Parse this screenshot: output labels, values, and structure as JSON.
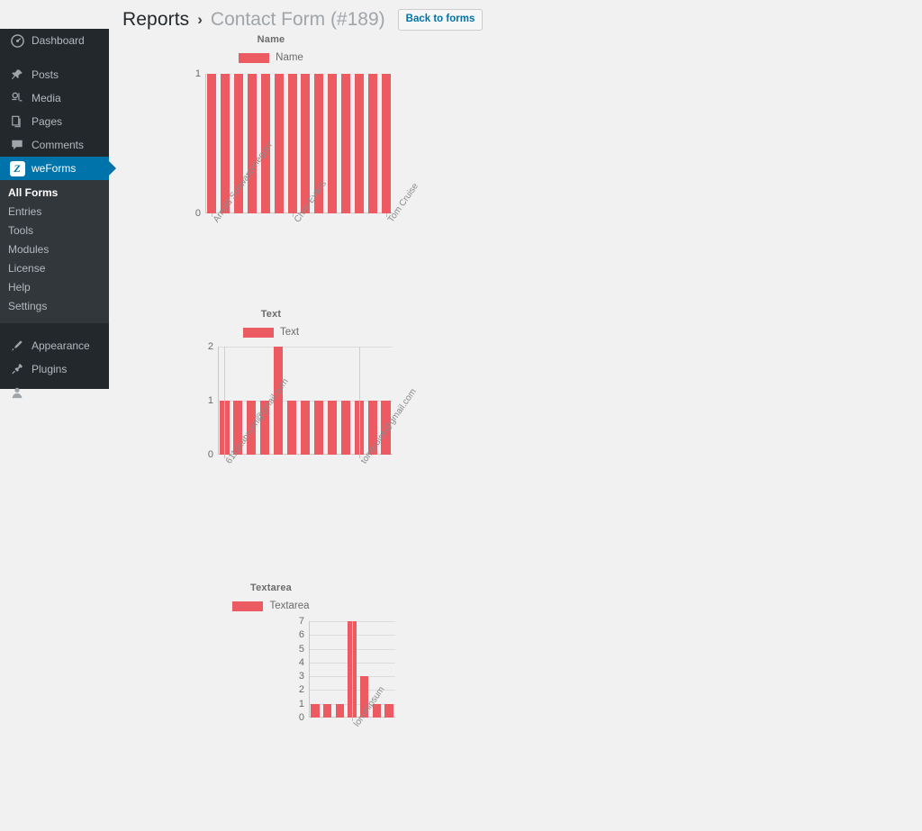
{
  "header": {
    "breadcrumb_root": "Reports",
    "breadcrumb_separator": "›",
    "form_name": "Contact Form (#189)",
    "back_button": "Back to forms"
  },
  "sidebar": {
    "items": [
      {
        "label": "Dashboard",
        "icon": "dashboard-icon",
        "active": false
      },
      {
        "label": "Posts",
        "icon": "pin-icon",
        "active": false
      },
      {
        "label": "Media",
        "icon": "media-icon",
        "active": false
      },
      {
        "label": "Pages",
        "icon": "pages-icon",
        "active": false
      },
      {
        "label": "Comments",
        "icon": "comments-icon",
        "active": false
      },
      {
        "label": "weForms",
        "icon": "weforms-icon",
        "active": true
      },
      {
        "label": "Appearance",
        "icon": "appearance-icon",
        "active": false
      },
      {
        "label": "Plugins",
        "icon": "plugins-icon",
        "active": false
      }
    ],
    "submenu": [
      {
        "label": "All Forms",
        "current": true
      },
      {
        "label": "Entries",
        "current": false
      },
      {
        "label": "Tools",
        "current": false
      },
      {
        "label": "Modules",
        "current": false
      },
      {
        "label": "License",
        "current": false
      },
      {
        "label": "Help",
        "current": false
      },
      {
        "label": "Settings",
        "current": false
      }
    ]
  },
  "colors": {
    "bar": "#ec5b62",
    "accent": "#0073aa",
    "sidebar_bg": "#23282d",
    "submenu_bg": "#32373c",
    "page_bg": "#f1f1f1"
  },
  "chart_data": [
    {
      "type": "bar",
      "title": "Name",
      "legend": [
        "Name"
      ],
      "legend_position": "top",
      "grid": false,
      "ylim": [
        0,
        1
      ],
      "yticks": [
        0,
        1
      ],
      "xlabel": "",
      "ylabel": "",
      "categories": [
        "Arnold Schwarzenegger",
        "",
        "",
        "",
        "",
        "",
        "Chris Evans",
        "",
        "",
        "",
        "",
        "",
        "",
        "Tom Cruise"
      ],
      "tick_labels": [
        "Arnold Schwarzenegger",
        "Chris Evans",
        "Tom Cruise"
      ],
      "values": [
        1,
        1,
        1,
        1,
        1,
        1,
        1,
        1,
        1,
        1,
        1,
        1,
        1,
        1
      ]
    },
    {
      "type": "bar",
      "title": "Text",
      "legend": [
        "Text"
      ],
      "legend_position": "top",
      "grid": true,
      "ylim": [
        0,
        2
      ],
      "yticks": [
        0,
        1,
        2
      ],
      "xlabel": "",
      "ylabel": "",
      "categories": [
        "611shabnam@gmail.com",
        "",
        "",
        "",
        "",
        "",
        "",
        "",
        "",
        "",
        "tomcruise@gmail.com",
        "",
        ""
      ],
      "tick_labels": [
        "611shabnam@gmail.com",
        "tomcruise@gmail.com"
      ],
      "values": [
        1,
        1,
        1,
        1,
        2,
        1,
        1,
        1,
        1,
        1,
        1,
        1,
        1
      ]
    },
    {
      "type": "bar",
      "title": "Textarea",
      "legend": [
        "Textarea"
      ],
      "legend_position": "top",
      "grid": true,
      "ylim": [
        0,
        7
      ],
      "yticks": [
        0,
        1,
        2,
        3,
        4,
        5,
        6,
        7
      ],
      "xlabel": "",
      "ylabel": "",
      "categories": [
        "",
        "",
        "",
        "loremipsum",
        "",
        "",
        ""
      ],
      "tick_labels": [
        "loremipsum"
      ],
      "values": [
        1,
        1,
        1,
        7,
        3,
        1,
        1
      ]
    }
  ]
}
